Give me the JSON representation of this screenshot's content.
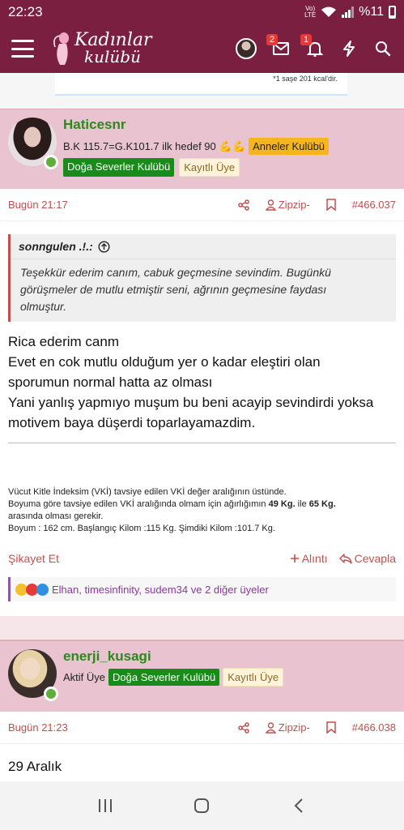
{
  "status_bar": {
    "time": "22:23",
    "network": "Vol) LTE",
    "battery": "%11"
  },
  "header": {
    "logo_line1": "Kadınlar",
    "logo_line2": "kulübü",
    "messages_badge": "2",
    "notifications_badge": "1"
  },
  "ad": {
    "text": "*1 saşe 201 kcal'dir."
  },
  "post1": {
    "username": "Haticesnr",
    "user_title": "B.K 115.7=G.K101.7 ilk hedef 90",
    "title_emojis": "💪💪",
    "tags": [
      "Anneler Kulübü",
      "Doğa Severler Kulübü",
      "Kayıtlı Üye"
    ],
    "time": "Bugün 21:17",
    "zipzip": "Zipzip-",
    "post_number": "#466.037",
    "quote": {
      "author": "sonngulen .!.:",
      "lines": [
        "Teşekkür ederim canım, cabuk geçmesine sevindim. Bugünkü",
        "görüşmeler de mutlu etmiştir seni, ağrının geçmesine faydası",
        "olmuştur."
      ]
    },
    "body": [
      "Rica ederim canm",
      "Evet en cok mutlu olduğum yer o kadar eleştiri olan",
      "sporumun normal hatta az olması",
      "Yani yanlış yapmıyo muşum bu beni acayip sevindirdi yoksa",
      "motivem baya düşerdi toparlayamazdim."
    ],
    "signature": {
      "line1": "Vücut Kitle İndeksim (VKİ) tavsiye edilen VKİ değer aralığının üstünde.",
      "line2_pre": "Boyuma göre tavsiye edilen VKİ aralığında olmam için ağırlığımın ",
      "line2_b1": "49 Kg.",
      "line2_mid": " ile ",
      "line2_b2": "65 Kg.",
      "line3": "arasında olması gerekir.",
      "line4": "Boyum : 162 cm. Başlangıç Kilom :115 Kg. Şimdiki Kilom :101.7 Kg."
    },
    "actions": {
      "report": "Şikayet Et",
      "quote": "Alıntı",
      "reply": "Cevapla"
    },
    "reactions_text": "Elhan, timesinfinity, sudem34 ve 2 diğer üyeler"
  },
  "post2": {
    "username": "enerji_kusagi",
    "user_title": "Aktif Üye",
    "tags": [
      "Doğa Severler Kulübü",
      "Kayıtlı Üye"
    ],
    "time": "Bugün 21:23",
    "zipzip": "Zipzip-",
    "post_number": "#466.038",
    "body_line1": "29 Aralık"
  },
  "colors": {
    "brand": "#7a1f40",
    "post_header_bg": "#e9c4d0",
    "username_green": "#2b8a19",
    "meta_red": "#c0504d",
    "tag_green": "#1a8a1a",
    "tag_orange": "#f7b51b"
  },
  "icons": {
    "menu": "hamburger-icon",
    "messages": "envelope-icon",
    "notifications": "bell-icon",
    "whats_new": "lightning-icon",
    "search": "search-icon",
    "share": "share-icon",
    "zipzip": "user-icon",
    "bookmark": "bookmark-icon",
    "quote_expand": "arrow-up-circle-icon",
    "quote_action": "plus-icon",
    "reply": "reply-icon"
  }
}
